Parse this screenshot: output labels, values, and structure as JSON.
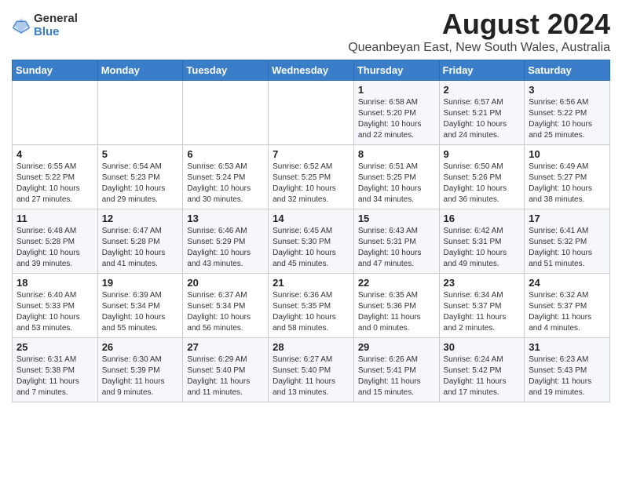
{
  "logo": {
    "general": "General",
    "blue": "Blue"
  },
  "title": "August 2024",
  "subtitle": "Queanbeyan East, New South Wales, Australia",
  "days_header": [
    "Sunday",
    "Monday",
    "Tuesday",
    "Wednesday",
    "Thursday",
    "Friday",
    "Saturday"
  ],
  "weeks": [
    [
      {
        "day": "",
        "info": ""
      },
      {
        "day": "",
        "info": ""
      },
      {
        "day": "",
        "info": ""
      },
      {
        "day": "",
        "info": ""
      },
      {
        "day": "1",
        "info": "Sunrise: 6:58 AM\nSunset: 5:20 PM\nDaylight: 10 hours\nand 22 minutes."
      },
      {
        "day": "2",
        "info": "Sunrise: 6:57 AM\nSunset: 5:21 PM\nDaylight: 10 hours\nand 24 minutes."
      },
      {
        "day": "3",
        "info": "Sunrise: 6:56 AM\nSunset: 5:22 PM\nDaylight: 10 hours\nand 25 minutes."
      }
    ],
    [
      {
        "day": "4",
        "info": "Sunrise: 6:55 AM\nSunset: 5:22 PM\nDaylight: 10 hours\nand 27 minutes."
      },
      {
        "day": "5",
        "info": "Sunrise: 6:54 AM\nSunset: 5:23 PM\nDaylight: 10 hours\nand 29 minutes."
      },
      {
        "day": "6",
        "info": "Sunrise: 6:53 AM\nSunset: 5:24 PM\nDaylight: 10 hours\nand 30 minutes."
      },
      {
        "day": "7",
        "info": "Sunrise: 6:52 AM\nSunset: 5:25 PM\nDaylight: 10 hours\nand 32 minutes."
      },
      {
        "day": "8",
        "info": "Sunrise: 6:51 AM\nSunset: 5:25 PM\nDaylight: 10 hours\nand 34 minutes."
      },
      {
        "day": "9",
        "info": "Sunrise: 6:50 AM\nSunset: 5:26 PM\nDaylight: 10 hours\nand 36 minutes."
      },
      {
        "day": "10",
        "info": "Sunrise: 6:49 AM\nSunset: 5:27 PM\nDaylight: 10 hours\nand 38 minutes."
      }
    ],
    [
      {
        "day": "11",
        "info": "Sunrise: 6:48 AM\nSunset: 5:28 PM\nDaylight: 10 hours\nand 39 minutes."
      },
      {
        "day": "12",
        "info": "Sunrise: 6:47 AM\nSunset: 5:28 PM\nDaylight: 10 hours\nand 41 minutes."
      },
      {
        "day": "13",
        "info": "Sunrise: 6:46 AM\nSunset: 5:29 PM\nDaylight: 10 hours\nand 43 minutes."
      },
      {
        "day": "14",
        "info": "Sunrise: 6:45 AM\nSunset: 5:30 PM\nDaylight: 10 hours\nand 45 minutes."
      },
      {
        "day": "15",
        "info": "Sunrise: 6:43 AM\nSunset: 5:31 PM\nDaylight: 10 hours\nand 47 minutes."
      },
      {
        "day": "16",
        "info": "Sunrise: 6:42 AM\nSunset: 5:31 PM\nDaylight: 10 hours\nand 49 minutes."
      },
      {
        "day": "17",
        "info": "Sunrise: 6:41 AM\nSunset: 5:32 PM\nDaylight: 10 hours\nand 51 minutes."
      }
    ],
    [
      {
        "day": "18",
        "info": "Sunrise: 6:40 AM\nSunset: 5:33 PM\nDaylight: 10 hours\nand 53 minutes."
      },
      {
        "day": "19",
        "info": "Sunrise: 6:39 AM\nSunset: 5:34 PM\nDaylight: 10 hours\nand 55 minutes."
      },
      {
        "day": "20",
        "info": "Sunrise: 6:37 AM\nSunset: 5:34 PM\nDaylight: 10 hours\nand 56 minutes."
      },
      {
        "day": "21",
        "info": "Sunrise: 6:36 AM\nSunset: 5:35 PM\nDaylight: 10 hours\nand 58 minutes."
      },
      {
        "day": "22",
        "info": "Sunrise: 6:35 AM\nSunset: 5:36 PM\nDaylight: 11 hours\nand 0 minutes."
      },
      {
        "day": "23",
        "info": "Sunrise: 6:34 AM\nSunset: 5:37 PM\nDaylight: 11 hours\nand 2 minutes."
      },
      {
        "day": "24",
        "info": "Sunrise: 6:32 AM\nSunset: 5:37 PM\nDaylight: 11 hours\nand 4 minutes."
      }
    ],
    [
      {
        "day": "25",
        "info": "Sunrise: 6:31 AM\nSunset: 5:38 PM\nDaylight: 11 hours\nand 7 minutes."
      },
      {
        "day": "26",
        "info": "Sunrise: 6:30 AM\nSunset: 5:39 PM\nDaylight: 11 hours\nand 9 minutes."
      },
      {
        "day": "27",
        "info": "Sunrise: 6:29 AM\nSunset: 5:40 PM\nDaylight: 11 hours\nand 11 minutes."
      },
      {
        "day": "28",
        "info": "Sunrise: 6:27 AM\nSunset: 5:40 PM\nDaylight: 11 hours\nand 13 minutes."
      },
      {
        "day": "29",
        "info": "Sunrise: 6:26 AM\nSunset: 5:41 PM\nDaylight: 11 hours\nand 15 minutes."
      },
      {
        "day": "30",
        "info": "Sunrise: 6:24 AM\nSunset: 5:42 PM\nDaylight: 11 hours\nand 17 minutes."
      },
      {
        "day": "31",
        "info": "Sunrise: 6:23 AM\nSunset: 5:43 PM\nDaylight: 11 hours\nand 19 minutes."
      }
    ]
  ]
}
